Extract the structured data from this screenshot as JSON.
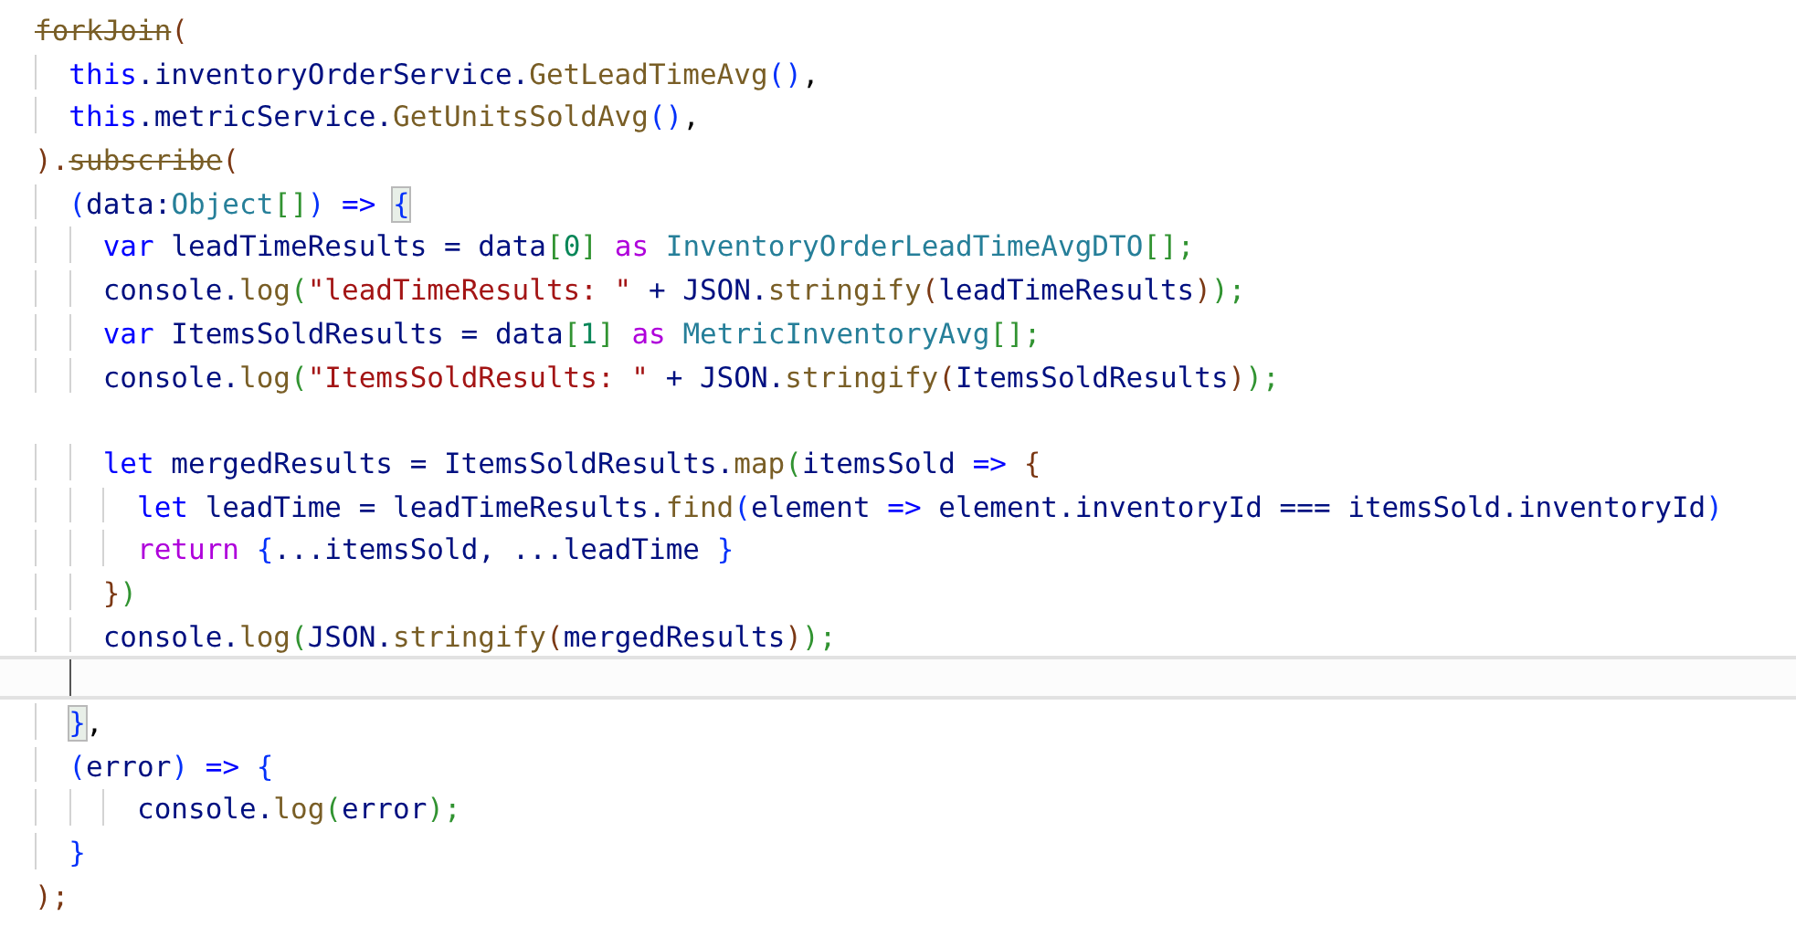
{
  "editor": {
    "lines": [
      {
        "current": false,
        "tokens": [
          {
            "text": "forkJoin",
            "kind": "dep"
          },
          {
            "text": "(",
            "kind": "b3"
          }
        ]
      },
      {
        "current": false,
        "tokens": [
          {
            "text": "  this",
            "kind": "kw"
          },
          {
            "text": ".inventoryOrderService.",
            "kind": "id"
          },
          {
            "text": "GetLeadTimeAvg",
            "kind": "fn"
          },
          {
            "text": "()",
            "kind": "b1"
          },
          {
            "text": ",",
            "kind": "p"
          }
        ]
      },
      {
        "current": false,
        "tokens": [
          {
            "text": "  this",
            "kind": "kw"
          },
          {
            "text": ".metricService.",
            "kind": "id"
          },
          {
            "text": "GetUnitsSoldAvg",
            "kind": "fn"
          },
          {
            "text": "()",
            "kind": "b1"
          },
          {
            "text": ",",
            "kind": "p"
          }
        ]
      },
      {
        "current": false,
        "tokens": [
          {
            "text": ").",
            "kind": "b3"
          },
          {
            "text": "subscribe",
            "kind": "dep"
          },
          {
            "text": "(",
            "kind": "b3"
          }
        ]
      },
      {
        "current": false,
        "tokens": [
          {
            "text": "  (",
            "kind": "b1"
          },
          {
            "text": "data:",
            "kind": "id"
          },
          {
            "text": "Object",
            "kind": "type"
          },
          {
            "text": "[]",
            "kind": "b2"
          },
          {
            "text": ")",
            "kind": "b1"
          },
          {
            "text": " => ",
            "kind": "kw"
          },
          {
            "text": "{",
            "kind": "b1m"
          }
        ]
      },
      {
        "current": false,
        "tokens": [
          {
            "text": "    var",
            "kind": "kw"
          },
          {
            "text": " leadTimeResults = data",
            "kind": "id"
          },
          {
            "text": "[",
            "kind": "b2"
          },
          {
            "text": "0",
            "kind": "num"
          },
          {
            "text": "]",
            "kind": "b2"
          },
          {
            "text": " as",
            "kind": "ctl"
          },
          {
            "text": " InventoryOrderLeadTimeAvgDTO",
            "kind": "type"
          },
          {
            "text": "[];",
            "kind": "b2"
          }
        ]
      },
      {
        "current": false,
        "tokens": [
          {
            "text": "    console.",
            "kind": "id"
          },
          {
            "text": "log",
            "kind": "fn"
          },
          {
            "text": "(",
            "kind": "b2"
          },
          {
            "text": "\"leadTimeResults: \"",
            "kind": "str"
          },
          {
            "text": " + JSON.",
            "kind": "id"
          },
          {
            "text": "stringify",
            "kind": "fn"
          },
          {
            "text": "(",
            "kind": "b3"
          },
          {
            "text": "leadTimeResults",
            "kind": "id"
          },
          {
            "text": ")",
            "kind": "b3"
          },
          {
            "text": ");",
            "kind": "b2"
          }
        ]
      },
      {
        "current": false,
        "tokens": [
          {
            "text": "    var",
            "kind": "kw"
          },
          {
            "text": " ItemsSoldResults = data",
            "kind": "id"
          },
          {
            "text": "[",
            "kind": "b2"
          },
          {
            "text": "1",
            "kind": "num"
          },
          {
            "text": "]",
            "kind": "b2"
          },
          {
            "text": " as",
            "kind": "ctl"
          },
          {
            "text": " MetricInventoryAvg",
            "kind": "type"
          },
          {
            "text": "[];",
            "kind": "b2"
          }
        ]
      },
      {
        "current": false,
        "tokens": [
          {
            "text": "    console.",
            "kind": "id"
          },
          {
            "text": "log",
            "kind": "fn"
          },
          {
            "text": "(",
            "kind": "b2"
          },
          {
            "text": "\"ItemsSoldResults: \"",
            "kind": "str"
          },
          {
            "text": " + JSON.",
            "kind": "id"
          },
          {
            "text": "stringify",
            "kind": "fn"
          },
          {
            "text": "(",
            "kind": "b3"
          },
          {
            "text": "ItemsSoldResults",
            "kind": "id"
          },
          {
            "text": ")",
            "kind": "b3"
          },
          {
            "text": ");",
            "kind": "b2"
          }
        ]
      },
      {
        "current": false
      },
      {
        "current": false,
        "tokens": [
          {
            "text": "    let",
            "kind": "kw"
          },
          {
            "text": " mergedResults = ItemsSoldResults.",
            "kind": "id"
          },
          {
            "text": "map",
            "kind": "fn"
          },
          {
            "text": "(",
            "kind": "b2"
          },
          {
            "text": "itemsSold",
            "kind": "id"
          },
          {
            "text": " => ",
            "kind": "kw"
          },
          {
            "text": "{",
            "kind": "b3"
          }
        ]
      },
      {
        "current": false,
        "tokens": [
          {
            "text": "      let",
            "kind": "kw"
          },
          {
            "text": " leadTime = leadTimeResults.",
            "kind": "id"
          },
          {
            "text": "find",
            "kind": "fn"
          },
          {
            "text": "(",
            "kind": "b1"
          },
          {
            "text": "element",
            "kind": "id"
          },
          {
            "text": " =>",
            "kind": "kw"
          },
          {
            "text": " element.inventoryId === itemsSold.inventoryId",
            "kind": "id"
          },
          {
            "text": ")",
            "kind": "b1"
          }
        ]
      },
      {
        "current": false,
        "tokens": [
          {
            "text": "      return",
            "kind": "ctl"
          },
          {
            "text": " {",
            "kind": "b1"
          },
          {
            "text": "...itemsSold, ...leadTime",
            "kind": "id"
          },
          {
            "text": " }",
            "kind": "b1"
          }
        ]
      },
      {
        "current": false,
        "tokens": [
          {
            "text": "    }",
            "kind": "b3"
          },
          {
            "text": ")",
            "kind": "b2"
          }
        ]
      },
      {
        "current": false,
        "tokens": [
          {
            "text": "    console.",
            "kind": "id"
          },
          {
            "text": "log",
            "kind": "fn"
          },
          {
            "text": "(",
            "kind": "b2"
          },
          {
            "text": "JSON.",
            "kind": "id"
          },
          {
            "text": "stringify",
            "kind": "fn"
          },
          {
            "text": "(",
            "kind": "b3"
          },
          {
            "text": "mergedResults",
            "kind": "id"
          },
          {
            "text": ")",
            "kind": "b3"
          },
          {
            "text": ");",
            "kind": "b2"
          }
        ]
      },
      {
        "current": true
      },
      {
        "current": false,
        "tokens": [
          {
            "text": "  }",
            "kind": "b1m"
          },
          {
            "text": ",",
            "kind": "p"
          }
        ]
      },
      {
        "current": false,
        "tokens": [
          {
            "text": "  (",
            "kind": "b1"
          },
          {
            "text": "error",
            "kind": "id"
          },
          {
            "text": ")",
            "kind": "b1"
          },
          {
            "text": " =>",
            "kind": "kw"
          },
          {
            "text": " {",
            "kind": "b1"
          }
        ]
      },
      {
        "current": false,
        "tokens": [
          {
            "text": "      console.",
            "kind": "id"
          },
          {
            "text": "log",
            "kind": "fn"
          },
          {
            "text": "(",
            "kind": "b2"
          },
          {
            "text": "error",
            "kind": "id"
          },
          {
            "text": ");",
            "kind": "b2"
          }
        ]
      },
      {
        "current": false,
        "tokens": [
          {
            "text": "  }",
            "kind": "b1"
          }
        ]
      },
      {
        "current": false,
        "tokens": [
          {
            "text": ");",
            "kind": "b3"
          }
        ]
      }
    ]
  }
}
